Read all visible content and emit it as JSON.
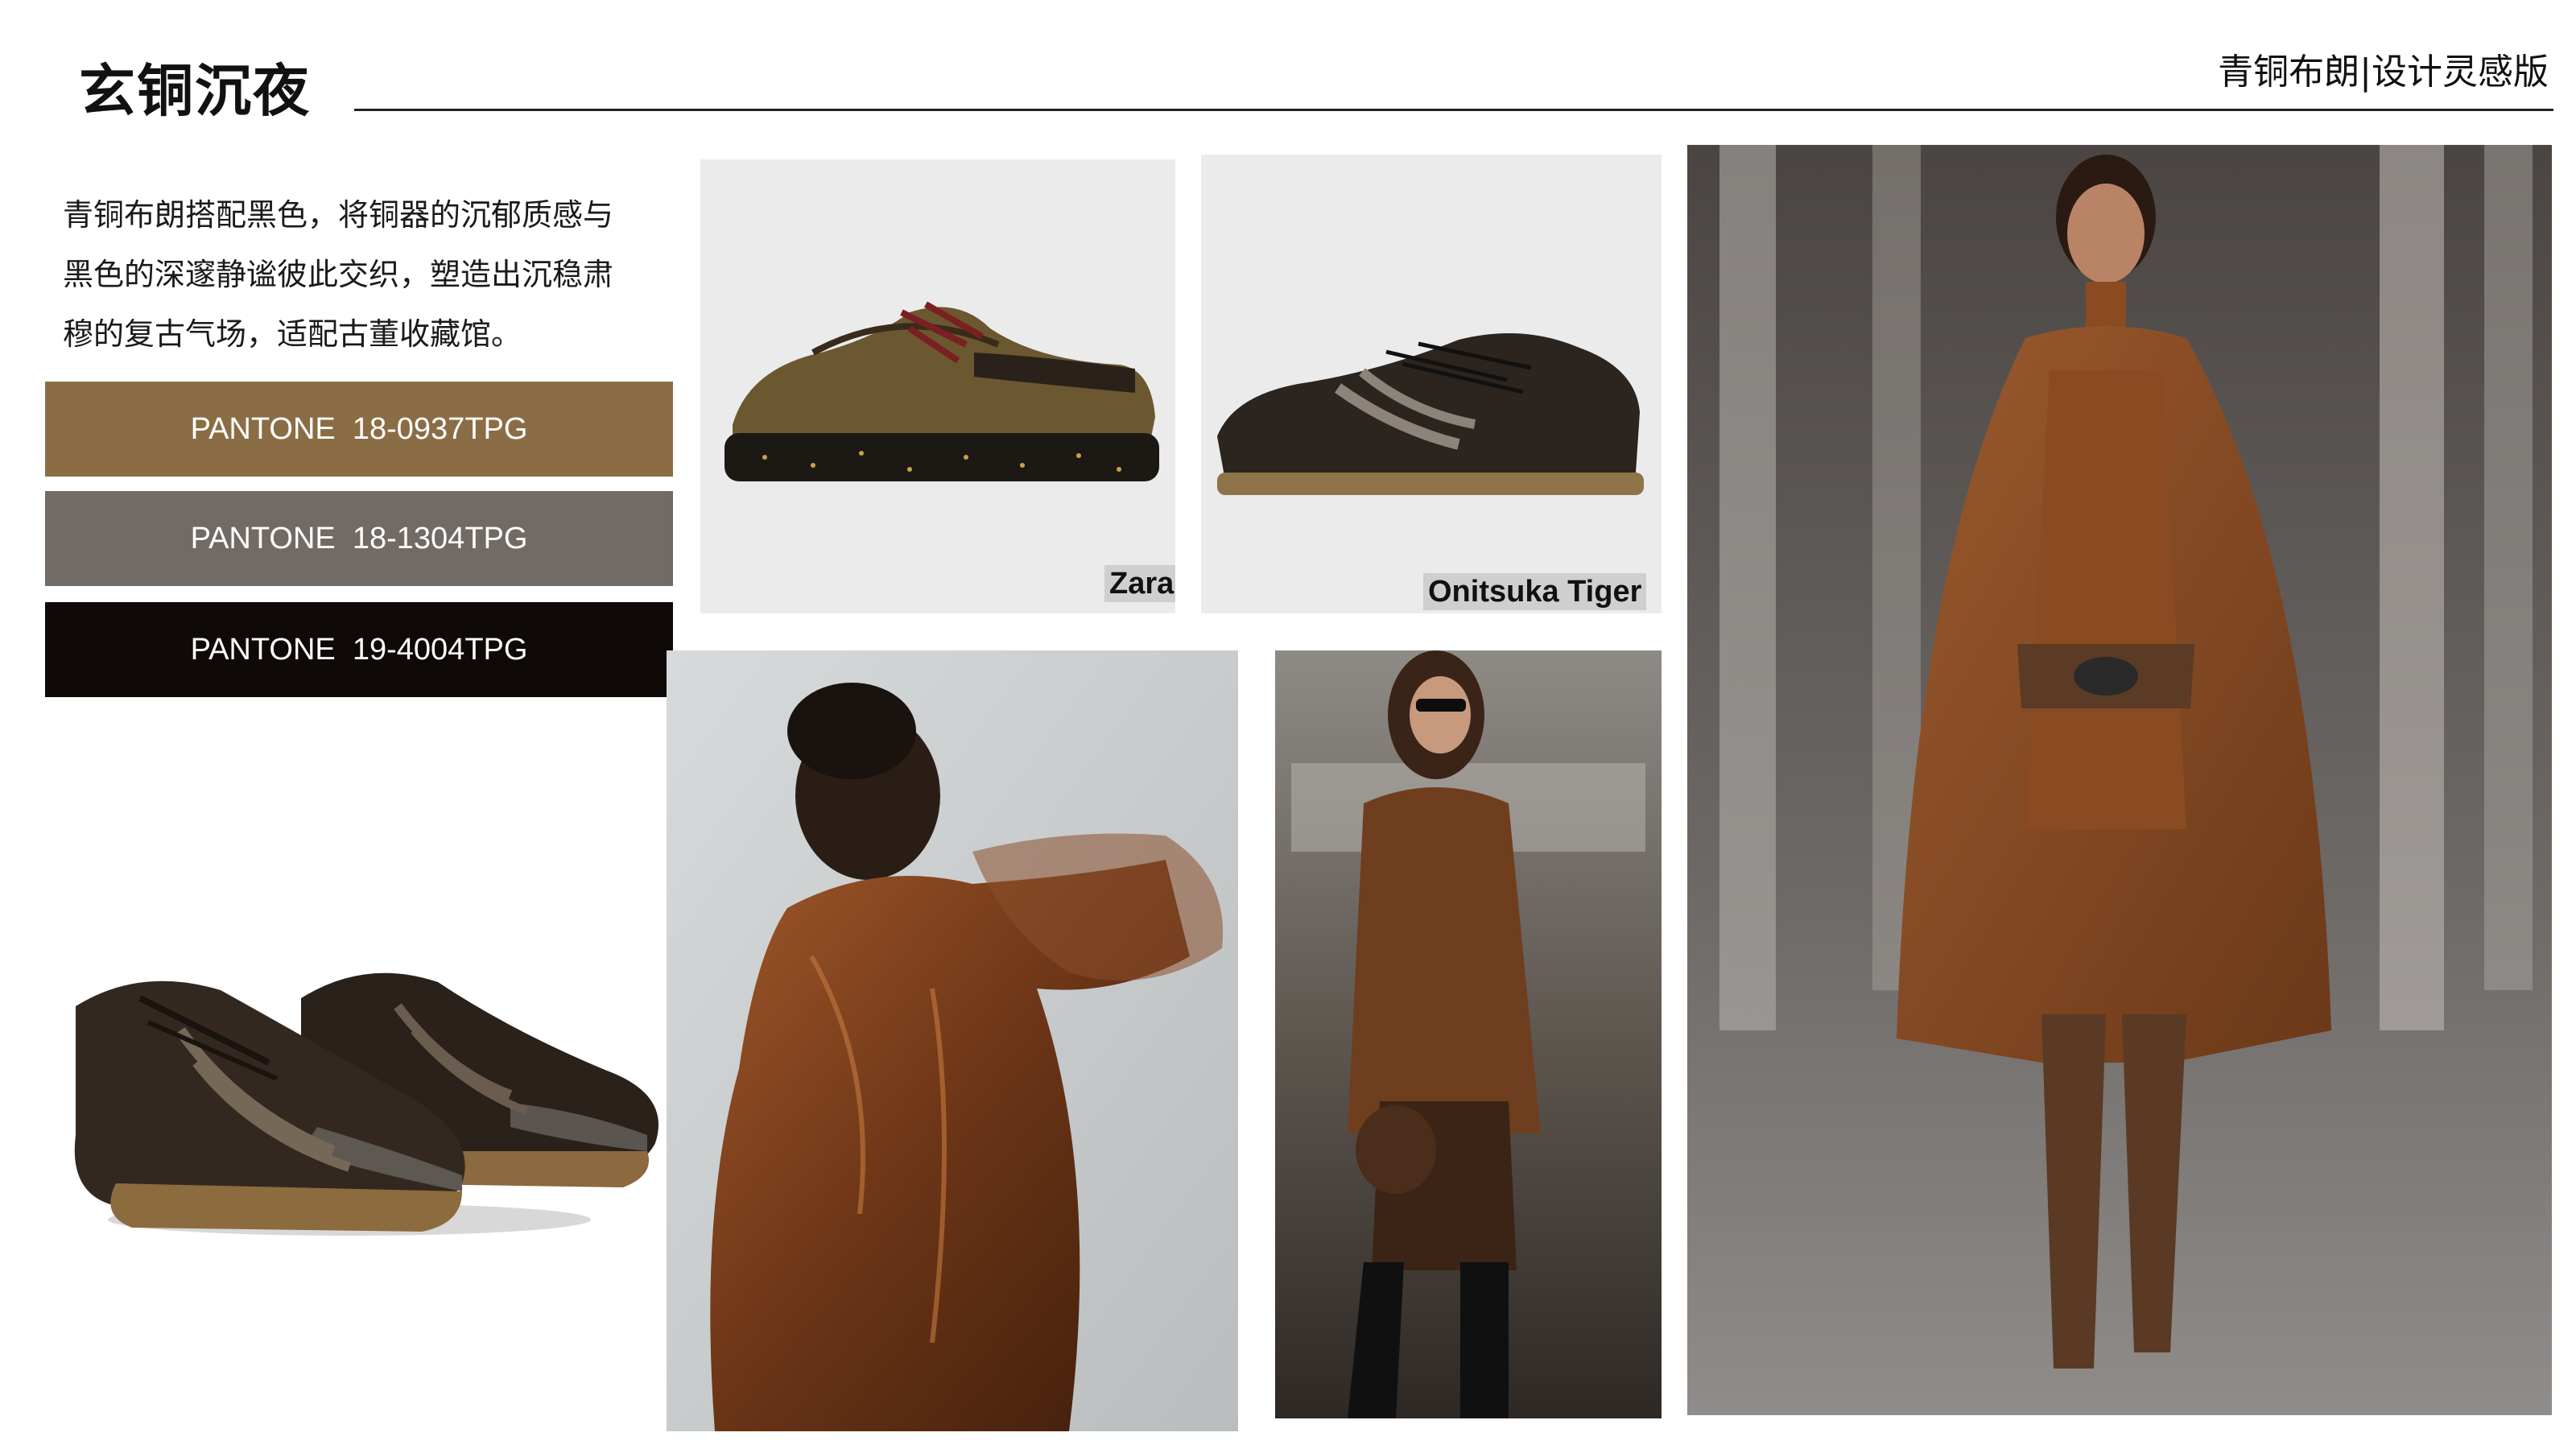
{
  "header": {
    "title": "玄铜沉夜",
    "subtitle": "青铜布朗|设计灵感版"
  },
  "description": {
    "lines": [
      "青铜布朗搭配黑色，将铜器的沉郁质感与",
      "黑色的深邃静谧彼此交织，塑造出沉稳肃",
      "穆的复古气场，适配古董收藏馆。"
    ]
  },
  "pantone": {
    "swatches": [
      {
        "label": "PANTONE  18-0937TPG",
        "color": "#8b6d45"
      },
      {
        "label": "PANTONE  18-1304TPG",
        "color": "#716a65"
      },
      {
        "label": "PANTONE  19-4004TPG",
        "color": "#0f0a07"
      }
    ]
  },
  "products": {
    "zara_label": "Zara",
    "onitsuka_label": "Onitsuka Tiger"
  },
  "palette": {
    "bronze": "#8b6d45",
    "taupe": "#716a65",
    "black": "#0f0a07",
    "rust": "#8a4a22"
  }
}
